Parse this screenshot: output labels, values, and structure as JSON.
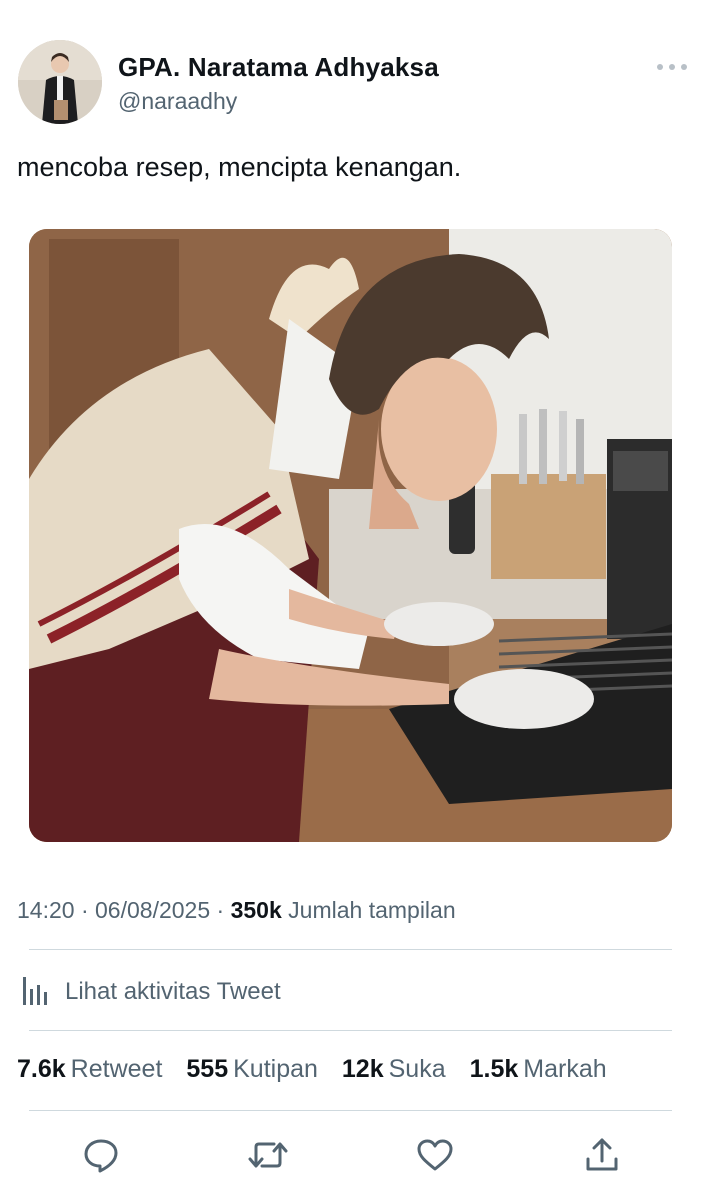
{
  "author": {
    "display_name": "GPA. Naratama Adhyaksa",
    "handle": "@naraadhy"
  },
  "tweet": {
    "text": "mencoba resep, mencipta kenangan."
  },
  "meta": {
    "time": "14:20",
    "date": "06/08/2025",
    "separator": "·",
    "views_count": "350k",
    "views_label": "Jumlah tampilan"
  },
  "activity": {
    "label": "Lihat aktivitas Tweet"
  },
  "stats": [
    {
      "count": "7.6k",
      "label": "Retweet"
    },
    {
      "count": "555",
      "label": "Kutipan"
    },
    {
      "count": "12k",
      "label": "Suka"
    },
    {
      "count": "1.5k",
      "label": "Markah"
    }
  ],
  "icons": {
    "more": "more-dots-icon",
    "activity": "bar-chart-icon",
    "reply": "reply-icon",
    "retweet": "retweet-icon",
    "like": "heart-icon",
    "share": "share-icon"
  },
  "colors": {
    "text_primary": "#0f1419",
    "text_secondary": "#536471",
    "divider": "#cfd9de"
  }
}
